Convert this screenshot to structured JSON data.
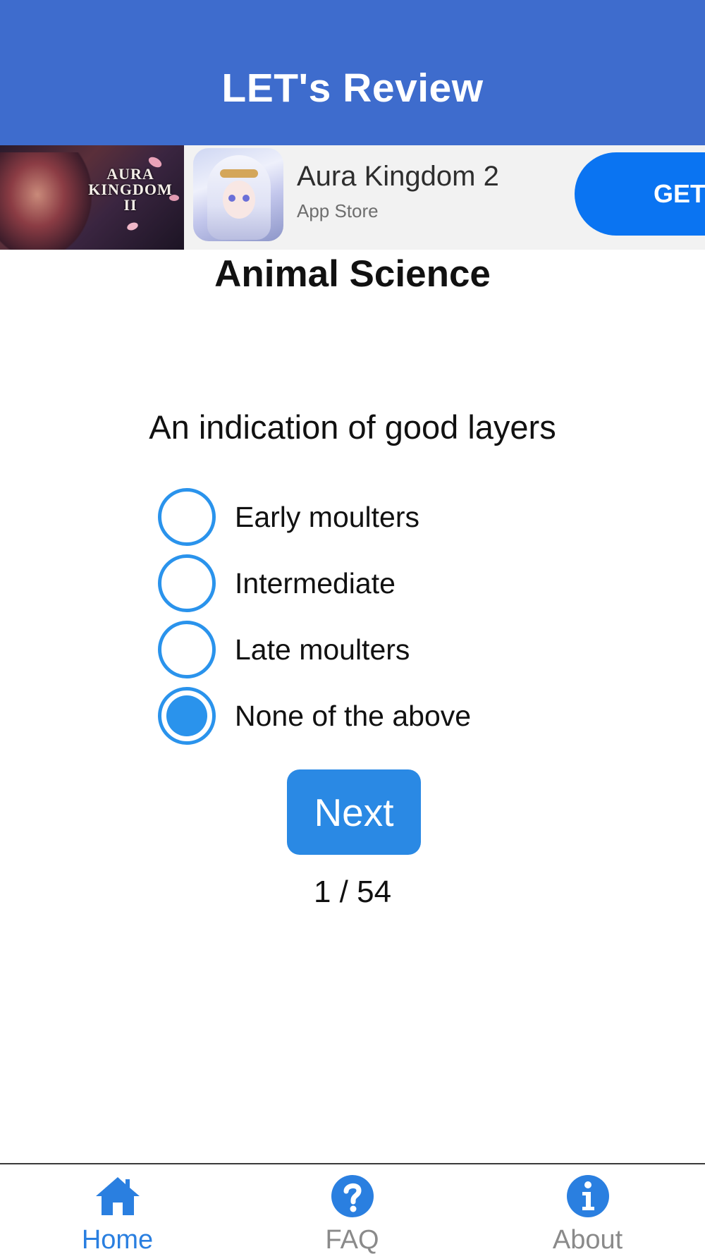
{
  "header": {
    "title": "LET's Review"
  },
  "ad": {
    "banner_brand": "AURA KINGDOM II",
    "app_name": "Aura Kingdom 2",
    "store": "App Store",
    "cta_label": "GET"
  },
  "quiz": {
    "subject": "Animal Science",
    "question": "An indication of good layers",
    "options": [
      {
        "label": "Early moulters",
        "selected": false
      },
      {
        "label": "Intermediate",
        "selected": false
      },
      {
        "label": "Late moulters",
        "selected": false
      },
      {
        "label": "None of the above",
        "selected": true
      }
    ],
    "next_label": "Next",
    "progress": "1 / 54"
  },
  "tabs": [
    {
      "label": "Home",
      "icon": "home-icon",
      "active": true
    },
    {
      "label": "FAQ",
      "icon": "question-icon",
      "active": false
    },
    {
      "label": "About",
      "icon": "info-icon",
      "active": false
    }
  ],
  "colors": {
    "header": "#3e6ccd",
    "accent": "#2a93ec",
    "button": "#2a89e4",
    "active_tab": "#2a7fe0",
    "inactive_tab": "#8a8a8a",
    "ad_cta": "#0a74f2"
  }
}
